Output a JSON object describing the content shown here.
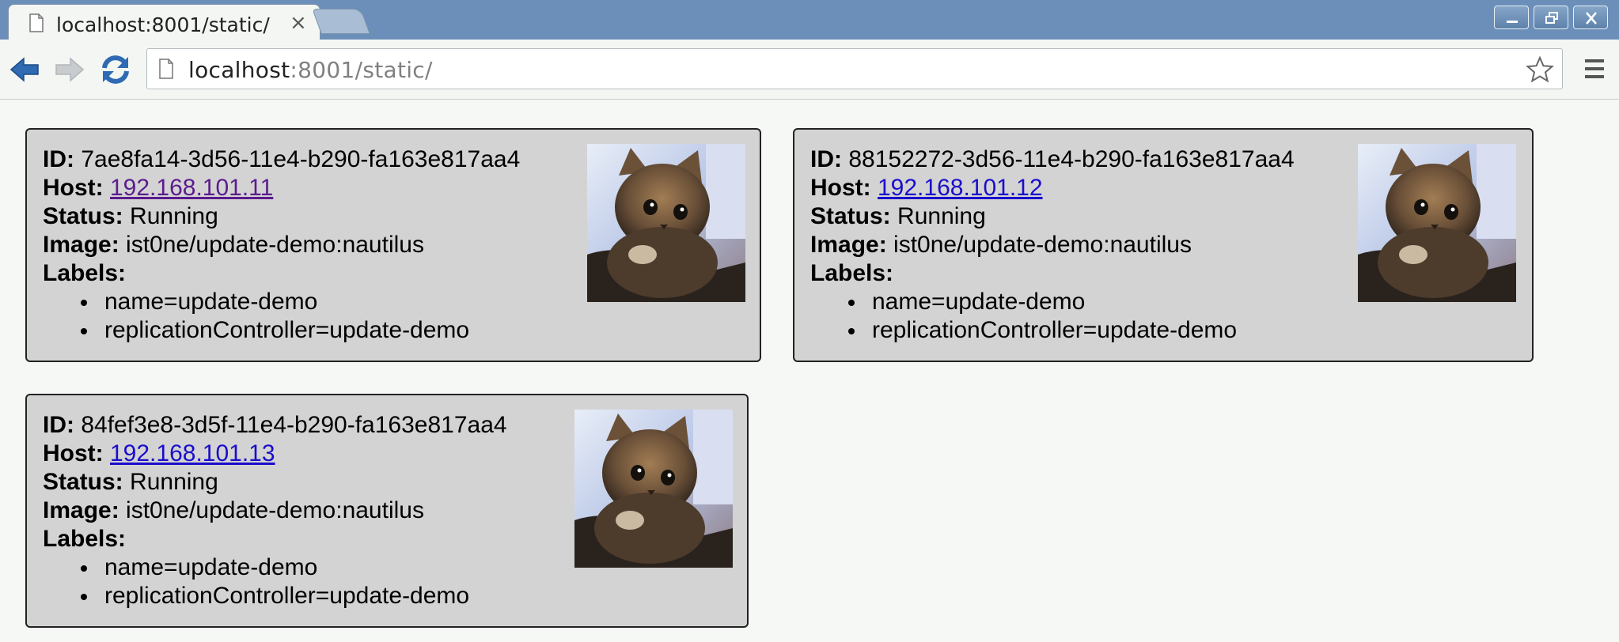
{
  "browser": {
    "tab_title": "localhost:8001/static/",
    "tab_close": "×",
    "url_host": "localhost",
    "url_rest": ":8001/static/"
  },
  "pods": [
    {
      "id_label": "ID:",
      "id": "7ae8fa14-3d56-11e4-b290-fa163e817aa4",
      "host_label": "Host:",
      "host": "192.168.101.11",
      "status_label": "Status:",
      "status": "Running",
      "image_label": "Image:",
      "image": "ist0ne/update-demo:nautilus",
      "labels_label": "Labels:",
      "labels": [
        "name=update-demo",
        "replicationController=update-demo"
      ]
    },
    {
      "id_label": "ID:",
      "id": "88152272-3d56-11e4-b290-fa163e817aa4",
      "host_label": "Host:",
      "host": "192.168.101.12",
      "status_label": "Status:",
      "status": "Running",
      "image_label": "Image:",
      "image": "ist0ne/update-demo:nautilus",
      "labels_label": "Labels:",
      "labels": [
        "name=update-demo",
        "replicationController=update-demo"
      ]
    },
    {
      "id_label": "ID:",
      "id": "84fef3e8-3d5f-11e4-b290-fa163e817aa4",
      "host_label": "Host:",
      "host": "192.168.101.13",
      "status_label": "Status:",
      "status": "Running",
      "image_label": "Image:",
      "image": "ist0ne/update-demo:nautilus",
      "labels_label": "Labels:",
      "labels": [
        "name=update-demo",
        "replicationController=update-demo"
      ]
    }
  ]
}
